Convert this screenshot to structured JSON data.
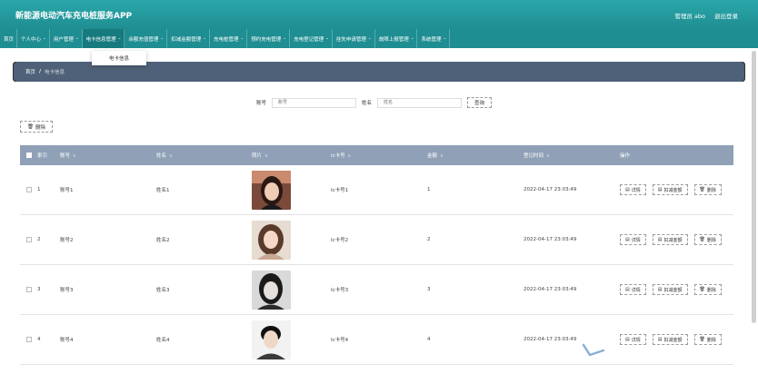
{
  "app": {
    "title": "新能源电动汽车充电桩服务APP"
  },
  "user": {
    "greeting": "管理员 abo",
    "logout": "退出登录"
  },
  "nav": [
    {
      "label": "首页",
      "has_menu": false
    },
    {
      "label": "个人中心",
      "has_menu": true
    },
    {
      "label": "用户管理",
      "has_menu": true
    },
    {
      "label": "电卡信息管理",
      "has_menu": true
    },
    {
      "label": "余额充值管理",
      "has_menu": true
    },
    {
      "label": "扣减金额管理",
      "has_menu": true
    },
    {
      "label": "充电桩管理",
      "has_menu": true
    },
    {
      "label": "预约充电管理",
      "has_menu": true
    },
    {
      "label": "充电登记管理",
      "has_menu": true
    },
    {
      "label": "挂失申请管理",
      "has_menu": true
    },
    {
      "label": "故障上报管理",
      "has_menu": true
    },
    {
      "label": "系统管理",
      "has_menu": true
    }
  ],
  "dropdown": {
    "item": "电卡信息"
  },
  "breadcrumb": {
    "home": "首页",
    "separator": "/",
    "current": "电卡信息"
  },
  "search": {
    "account_label": "账号",
    "account_placeholder": "账号",
    "name_label": "姓名",
    "name_placeholder": "姓名",
    "button": "查询"
  },
  "toolbar": {
    "delete": "删除"
  },
  "table": {
    "headers": {
      "index": "索引",
      "account": "账号",
      "name": "姓名",
      "photo": "照片",
      "ic": "Ic卡号",
      "amount": "金额",
      "time": "登记时间",
      "ops": "操作"
    },
    "rows": [
      {
        "index": "1",
        "account": "账号1",
        "name": "姓名1",
        "ic": "Ic卡号1",
        "amount": "1",
        "time": "2022-04-17 23:03:49",
        "photo": "avatar-1"
      },
      {
        "index": "2",
        "account": "账号2",
        "name": "姓名2",
        "ic": "Ic卡号2",
        "amount": "2",
        "time": "2022-04-17 23:03:49",
        "photo": "avatar-2"
      },
      {
        "index": "3",
        "account": "账号3",
        "name": "姓名3",
        "ic": "Ic卡号3",
        "amount": "3",
        "time": "2022-04-17 23:03:49",
        "photo": "avatar-3"
      },
      {
        "index": "4",
        "account": "账号4",
        "name": "姓名4",
        "ic": "Ic卡号4",
        "amount": "4",
        "time": "2022-04-17 23:03:49",
        "photo": "avatar-4"
      }
    ],
    "ops": {
      "detail": "详情",
      "deduct": "扣减金额",
      "delete": "删除"
    }
  },
  "colors": {
    "header": "#1f8e92",
    "breadcrumb": "#4e6178",
    "table_head": "#8fa0b7"
  }
}
